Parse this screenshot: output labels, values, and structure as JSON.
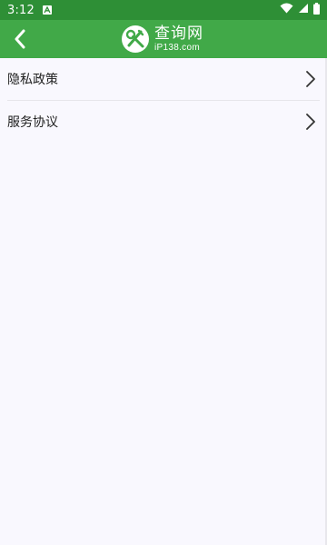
{
  "status_bar": {
    "time": "3:12",
    "icons": [
      "notification-a-icon",
      "wifi-icon",
      "cellular-signal-icon",
      "battery-icon"
    ]
  },
  "app_bar": {
    "logo_title": "查询网",
    "logo_domain": "iP138.com",
    "logo_icon": "tools-icon",
    "back_icon": "back-arrow-icon"
  },
  "menu": {
    "items": [
      {
        "label": "隐私政策",
        "icon": "chevron-right-icon"
      },
      {
        "label": "服务协议",
        "icon": "chevron-right-icon"
      }
    ]
  },
  "colors": {
    "status_bar": "#2e8f36",
    "app_bar": "#41a948",
    "background": "#f9f8fe",
    "text": "#222222",
    "divider": "#e6e5ea"
  }
}
